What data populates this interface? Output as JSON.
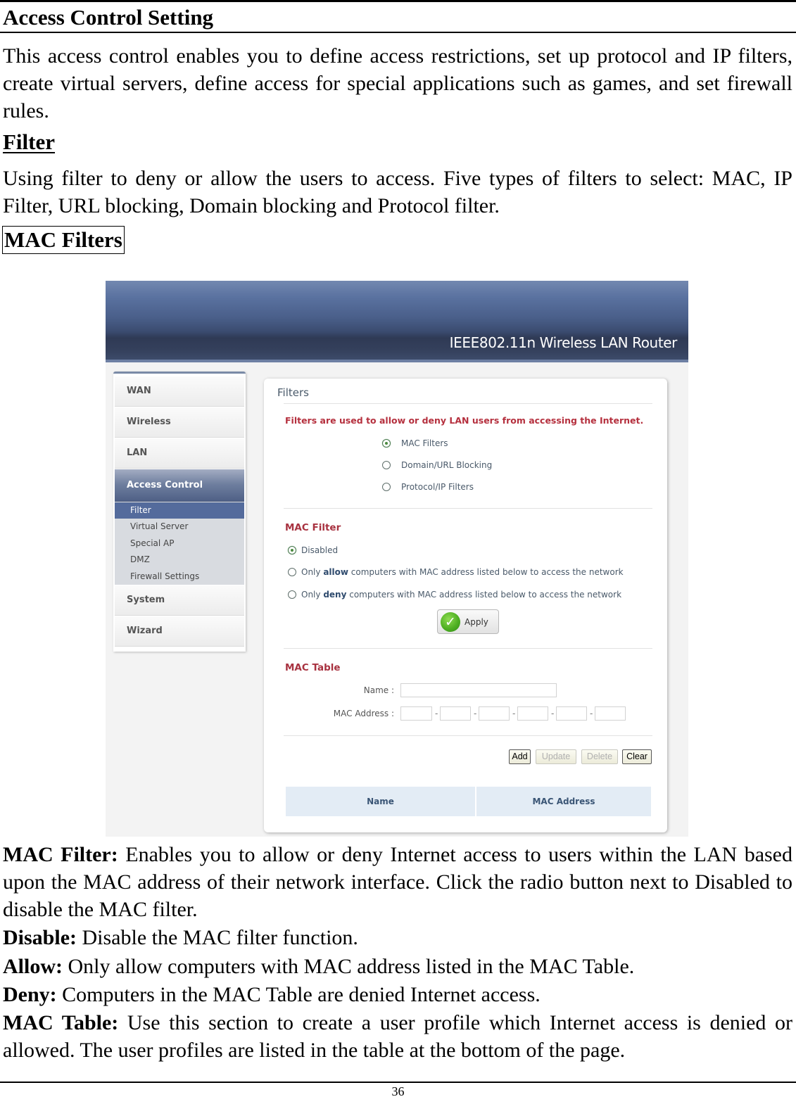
{
  "document": {
    "title": "Access Control Setting",
    "intro": "This access control enables you to define access restrictions, set up protocol and IP filters, create virtual servers, define access for special applications such as games, and set firewall rules.",
    "filter_heading": "Filter",
    "filter_text": "Using filter to deny or allow the users to access.  Five types of filters to select: MAC, IP Filter, URL blocking, Domain blocking and Protocol filter.",
    "mac_filters_heading": "MAC Filters",
    "descriptions": [
      {
        "term": "MAC Filter:",
        "text": " Enables you to allow or deny Internet access to users within the LAN based upon the MAC address of their network interface. Click the radio button next to Disabled to disable the MAC filter."
      },
      {
        "term": "Disable:",
        "text": " Disable the MAC filter function."
      },
      {
        "term": "Allow:",
        "text": " Only allow computers with MAC address listed in the MAC Table."
      },
      {
        "term": "Deny:",
        "text": " Computers in the MAC Table are denied Internet access."
      },
      {
        "term": "MAC Table:",
        "text": " Use this section to create a user profile which Internet access is denied or allowed.  The user profiles are listed in the table at the bottom of the page."
      }
    ],
    "page_number": "36"
  },
  "screenshot": {
    "banner_title": "IEEE802.11n  Wireless LAN Router",
    "sidebar": {
      "items": [
        {
          "label": "WAN",
          "active": false
        },
        {
          "label": "Wireless",
          "active": false
        },
        {
          "label": "LAN",
          "active": false
        },
        {
          "label": "Access Control",
          "active": true
        },
        {
          "label": "System",
          "active": false
        },
        {
          "label": "Wizard",
          "active": false
        }
      ],
      "sub_items": [
        {
          "label": "Filter",
          "active": true
        },
        {
          "label": "Virtual Server",
          "active": false
        },
        {
          "label": "Special AP",
          "active": false
        },
        {
          "label": "DMZ",
          "active": false
        },
        {
          "label": "Firewall Settings",
          "active": false
        }
      ]
    },
    "panel": {
      "title": "Filters",
      "note": "Filters are used to allow or deny LAN users from accessing the Internet.",
      "filter_types": [
        {
          "label": "MAC Filters",
          "checked": true
        },
        {
          "label": "Domain/URL Blocking",
          "checked": false
        },
        {
          "label": "Protocol/IP Filters",
          "checked": false
        }
      ],
      "mac_filter": {
        "title": "MAC Filter",
        "options": [
          {
            "prefix": "Disabled",
            "bold": "",
            "suffix": "",
            "checked": true
          },
          {
            "prefix": "Only ",
            "bold": "allow",
            "suffix": " computers with MAC address listed below to access the network",
            "checked": false
          },
          {
            "prefix": "Only ",
            "bold": "deny",
            "suffix": " computers with MAC address listed below to access the network",
            "checked": false
          }
        ],
        "apply_label": "Apply"
      },
      "mac_table": {
        "title": "MAC Table",
        "name_label": "Name :",
        "name_value": "",
        "mac_label": "MAC Address :",
        "mac_values": [
          "",
          "",
          "",
          "",
          "",
          ""
        ],
        "separator": "-",
        "buttons": {
          "add": "Add",
          "update": "Update",
          "delete": "Delete",
          "clear": "Clear"
        },
        "columns": [
          "Name",
          "MAC Address"
        ]
      }
    }
  }
}
